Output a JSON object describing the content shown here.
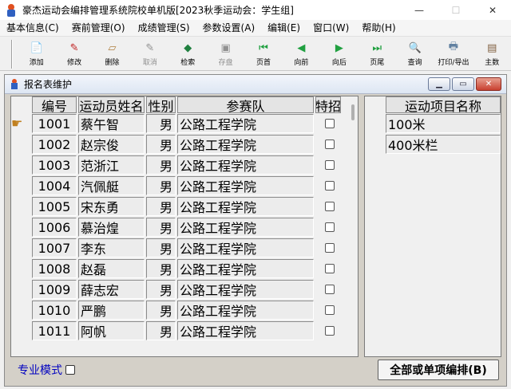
{
  "window": {
    "title": "豪杰运动会编排管理系统院校单机版[2023秋季运动会：学生组]",
    "controls": [
      "—",
      "☐",
      "✕"
    ]
  },
  "menu": [
    {
      "label": "基本信息(C)"
    },
    {
      "label": "赛前管理(O)"
    },
    {
      "label": "成绩管理(S)"
    },
    {
      "label": "参数设置(A)"
    },
    {
      "label": "编辑(E)"
    },
    {
      "label": "窗口(W)"
    },
    {
      "label": "帮助(H)"
    }
  ],
  "toolbar": [
    {
      "label": "添加",
      "icon": "add-doc-icon",
      "glyph": "📄",
      "color": "#2060c0",
      "disabled": false
    },
    {
      "label": "修改",
      "icon": "edit-icon",
      "glyph": "✎",
      "color": "#c02020",
      "disabled": false
    },
    {
      "label": "删除",
      "icon": "eraser-icon",
      "glyph": "▱",
      "color": "#b08040",
      "disabled": false
    },
    {
      "label": "取消",
      "icon": "cancel-icon",
      "glyph": "✎",
      "color": "#909090",
      "disabled": true
    },
    {
      "label": "检索",
      "icon": "search-icon",
      "glyph": "◆",
      "color": "#208040",
      "disabled": false
    },
    {
      "label": "存盘",
      "icon": "save-icon",
      "glyph": "▣",
      "color": "#909090",
      "disabled": true
    },
    {
      "label": "页首",
      "icon": "first-icon",
      "glyph": "⏮",
      "color": "#20a040",
      "disabled": false
    },
    {
      "label": "向前",
      "icon": "prev-icon",
      "glyph": "◀",
      "color": "#20a040",
      "disabled": false
    },
    {
      "label": "向后",
      "icon": "next-icon",
      "glyph": "▶",
      "color": "#20a040",
      "disabled": false
    },
    {
      "label": "页尾",
      "icon": "last-icon",
      "glyph": "⏭",
      "color": "#20a040",
      "disabled": false
    },
    {
      "label": "查询",
      "icon": "query-icon",
      "glyph": "🔍",
      "color": "#c08020",
      "disabled": false
    },
    {
      "label": "打印/导出",
      "icon": "print-icon",
      "glyph": "🖶",
      "color": "#6080a0",
      "disabled": false
    },
    {
      "label": "主数",
      "icon": "data-icon",
      "glyph": "▤",
      "color": "#806040",
      "disabled": false
    }
  ],
  "inner_window": {
    "title": "报名表维护",
    "controls": [
      "▁",
      "▭",
      "✕"
    ]
  },
  "grid": {
    "headers": [
      "编号",
      "运动员姓名",
      "性别",
      "参赛队",
      "特招"
    ],
    "rows": [
      {
        "id": "1001",
        "name": "蔡午智",
        "sex": "男",
        "team": "公路工程学院",
        "special": false
      },
      {
        "id": "1002",
        "name": "赵宗俊",
        "sex": "男",
        "team": "公路工程学院",
        "special": false
      },
      {
        "id": "1003",
        "name": "范浙江",
        "sex": "男",
        "team": "公路工程学院",
        "special": false
      },
      {
        "id": "1004",
        "name": "汽佩艇",
        "sex": "男",
        "team": "公路工程学院",
        "special": false
      },
      {
        "id": "1005",
        "name": "宋东勇",
        "sex": "男",
        "team": "公路工程学院",
        "special": false
      },
      {
        "id": "1006",
        "name": "慕治煌",
        "sex": "男",
        "team": "公路工程学院",
        "special": false
      },
      {
        "id": "1007",
        "name": "李东",
        "sex": "男",
        "team": "公路工程学院",
        "special": false
      },
      {
        "id": "1008",
        "name": "赵磊",
        "sex": "男",
        "team": "公路工程学院",
        "special": false
      },
      {
        "id": "1009",
        "name": "薛志宏",
        "sex": "男",
        "team": "公路工程学院",
        "special": false
      },
      {
        "id": "1010",
        "name": "严鹏",
        "sex": "男",
        "team": "公路工程学院",
        "special": false
      },
      {
        "id": "1011",
        "name": "阿帆",
        "sex": "男",
        "team": "公路工程学院",
        "special": false
      }
    ],
    "current_row_pointer": "☛"
  },
  "events": {
    "header": "运动项目名称",
    "items": [
      "100米",
      "400米栏"
    ]
  },
  "bottom": {
    "pro_mode_label": "专业模式",
    "arrange_button": "全部或单项编排(B)"
  }
}
